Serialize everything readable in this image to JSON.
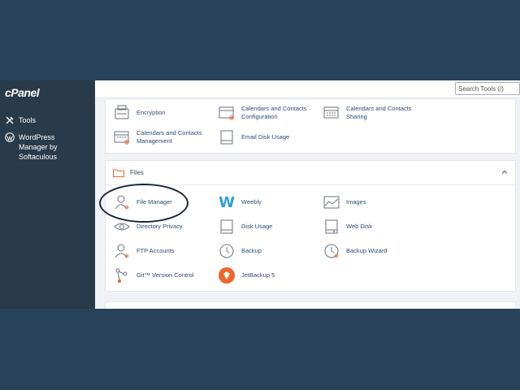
{
  "brand": {
    "logo": "cPanel"
  },
  "sidebar": {
    "items": [
      {
        "label": "Tools",
        "icon": "tools-icon"
      },
      {
        "label": "WordPress Manager by Softaculous",
        "icon": "wordpress-icon"
      }
    ]
  },
  "search": {
    "placeholder": "Search Tools (/)"
  },
  "security": {
    "tools": [
      {
        "label": "Encryption",
        "icon": "encryption-icon"
      },
      {
        "label": "Calendars and Contacts Configuration",
        "icon": "calendar-config-icon"
      },
      {
        "label": "Calendars and Contacts Sharing",
        "icon": "calendar-sharing-icon"
      },
      {
        "label": "Calendars and Contacts Management",
        "icon": "calendar-management-icon"
      },
      {
        "label": "Email Disk Usage",
        "icon": "email-disk-usage-icon"
      }
    ]
  },
  "files": {
    "title": "Files",
    "tools": [
      {
        "label": "File Manager",
        "icon": "file-manager-icon"
      },
      {
        "label": "Weebly",
        "icon": "weebly-icon"
      },
      {
        "label": "Images",
        "icon": "images-icon"
      },
      {
        "label": "Directory Privacy",
        "icon": "directory-privacy-icon"
      },
      {
        "label": "Disk Usage",
        "icon": "disk-usage-icon"
      },
      {
        "label": "Web Disk",
        "icon": "web-disk-icon"
      },
      {
        "label": "FTP Accounts",
        "icon": "ftp-accounts-icon"
      },
      {
        "label": "Backup",
        "icon": "backup-icon"
      },
      {
        "label": "Backup Wizard",
        "icon": "backup-wizard-icon"
      },
      {
        "label": "Git™ Version Control",
        "icon": "git-icon"
      },
      {
        "label": "JetBackup 5",
        "icon": "jetbackup-icon"
      }
    ]
  },
  "colors": {
    "sidebar": "#293a4a",
    "background": "#28425a",
    "link": "#2e4a7a",
    "accent": "#f0662a"
  }
}
